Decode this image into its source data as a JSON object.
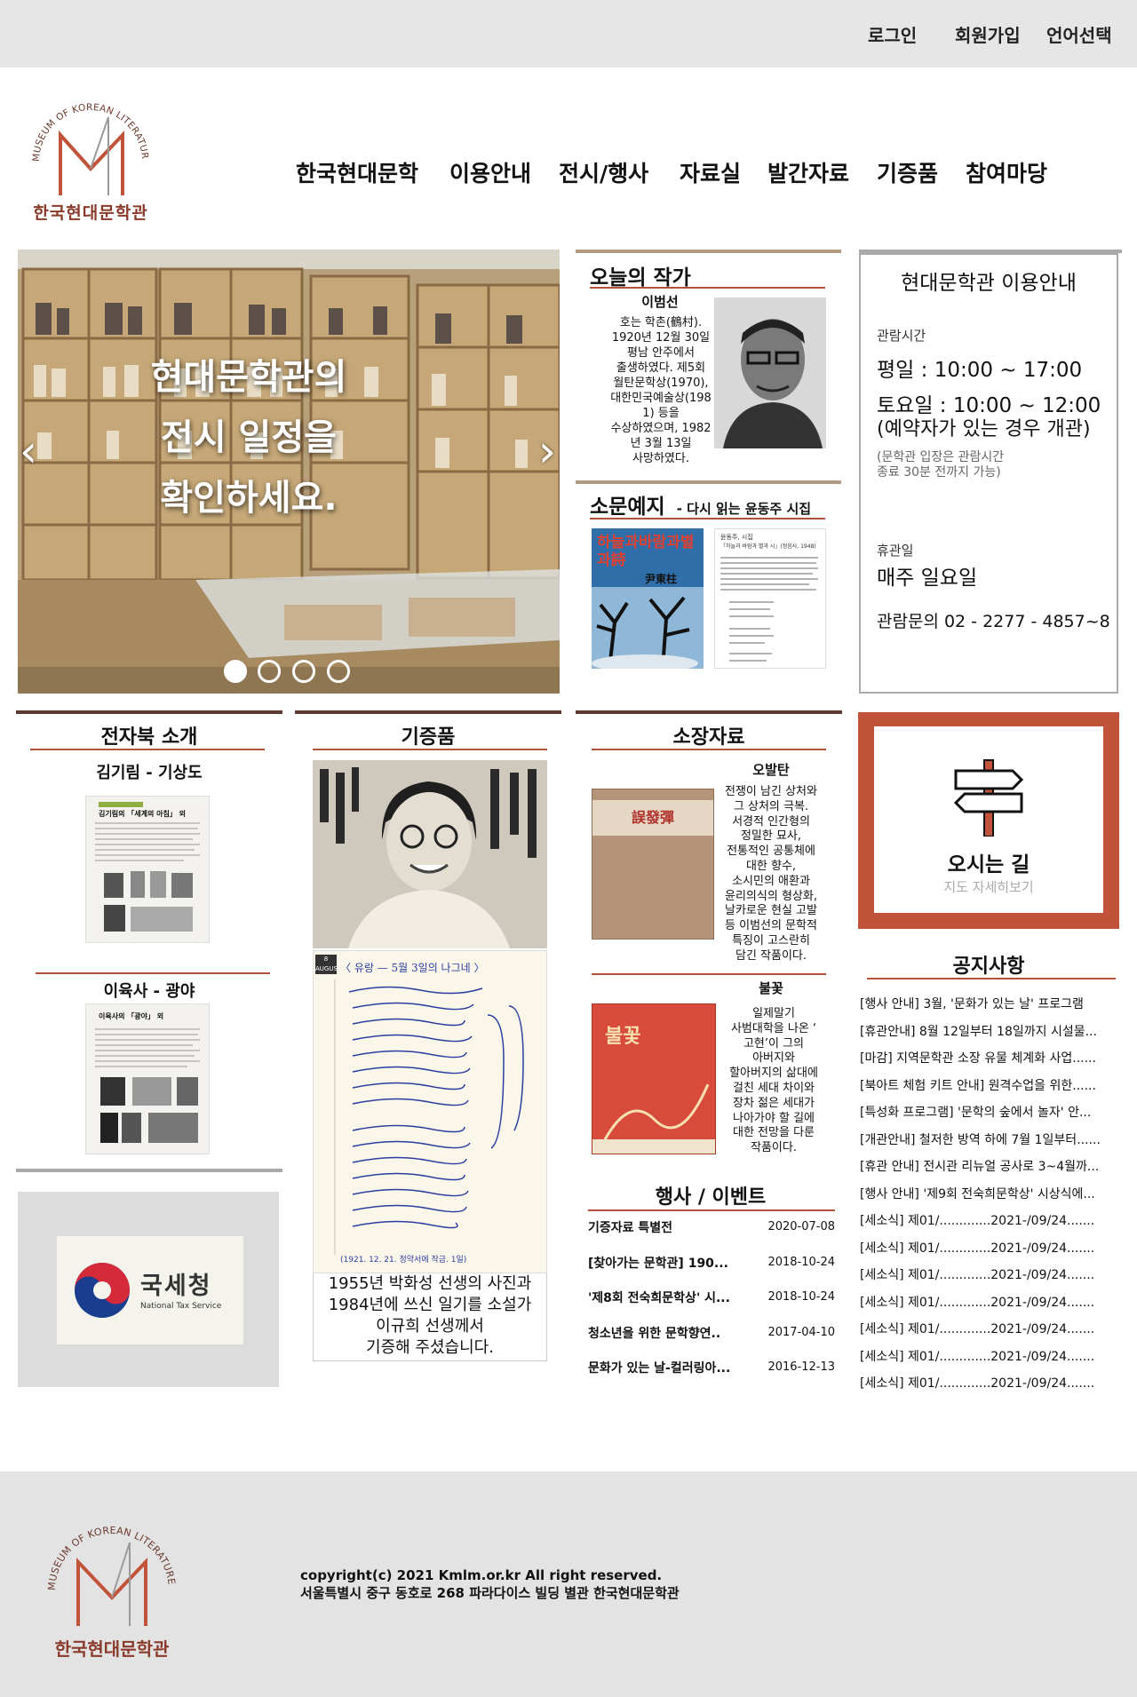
{
  "topbar": {
    "login": "로그인",
    "signup": "회원가입",
    "language": "언어선택"
  },
  "logo": {
    "arc_text": "MUSEUM OF KOREAN LITERATURE",
    "name": "한국현대문학관"
  },
  "nav": [
    "한국현대문학",
    "이용안내",
    "전시/행사",
    "자료실",
    "발간자료",
    "기증품",
    "참여마당"
  ],
  "hero": {
    "line1": "현대문학관의",
    "line2": "전시 일정을",
    "line3": "확인하세요.",
    "prev": "‹",
    "next": "›"
  },
  "author": {
    "title": "오늘의 작가",
    "name": "이범선",
    "bio": [
      "호는 학촌(鶴村).",
      "1920년 12월 30일",
      "평남 안주에서",
      "출생하였다. 제5회",
      "월탄문학상(1970),",
      "대한민국예술상(198",
      "1) 등을",
      "수상하였으며, 1982",
      "년 3월 13일",
      "사망하였다."
    ]
  },
  "newbook": {
    "title": "소문예지",
    "subtitle": "- 다시 읽는 윤동주 시집",
    "cover_title": "하늘과바람과별과詩",
    "cover_author": "尹東柱",
    "page_head": "윤동주, 시집",
    "page_sub": "「하늘과 바람과 별과 시」(정음사, 1948)"
  },
  "info": {
    "title": "현대문학관 이용안내",
    "hours_label": "관람시간",
    "weekday": "평일 : 10:00 ~ 17:00",
    "saturday": "토요일 : 10:00 ~ 12:00",
    "sat_note": "(예약자가 있는 경우 개관)",
    "entry_note1": "(문학관 입장은 관람시간",
    "entry_note2": "종료 30분 전까지 가능)",
    "closed_label": "휴관일",
    "closed": "매주 일요일",
    "contact": "관람문의 02 - 2277 - 4857~8"
  },
  "ebook": {
    "title": "전자북 소개",
    "items": [
      {
        "label": "김기림 - 기상도",
        "page_title": "김기림의 「세계의 아침」 외"
      },
      {
        "label": "이육사 - 광야",
        "page_title": "이육사의 「광야」 외"
      }
    ]
  },
  "donation": {
    "title": "기증품",
    "diary_date": "8 AUGUST",
    "diary_heading": "〈 유랑 — 5월 3일의 나그네 〉",
    "diary_footer": "(1921. 12. 21. 정약서에 작금. 1일)",
    "caption": [
      "1955년 박화성 선생의 사진과",
      "1984년에 쓰신 일기를 소설가",
      "이규희 선생께서",
      "기증해 주셨습니다."
    ]
  },
  "collection": {
    "title": "소장자료",
    "items": [
      {
        "name": "오발탄",
        "cover_title": "誤發彈",
        "desc": [
          "전쟁이 남긴 상처와",
          "그 상처의 극복.",
          "서경적 인간형의",
          "정밀한 묘사,",
          "전통적인 공통체에",
          "대한 향수,",
          "소시민의 애환과",
          "윤리의식의 형상화,",
          "날카로운 현실 고발",
          "등 이범선의 문학적",
          "특징이 고스란히",
          "담긴 작품이다."
        ]
      },
      {
        "name": "불꽃",
        "cover_title": "불꽃",
        "desc": [
          "일제말기",
          "사범대학을 나온 ‘",
          "고현’이 그의",
          "아버지와",
          "할아버지의 삶대에",
          "걸친 세대 차이와",
          "장차 젊은 세대가",
          "나아가야 할 길에",
          "대한 전망을 다룬",
          "작품이다."
        ]
      }
    ]
  },
  "directions": {
    "title": "오시는 길",
    "link": "지도 자세히보기",
    "icon": "signpost-icon"
  },
  "notices": {
    "title": "공지사항",
    "items": [
      "[행사 안내] 3월, '문화가 있는 날' 프로그램",
      "[휴관안내] 8월 12일부터 18일까지 시설물...",
      "[마감] 지역문학관 소장 유물 체계화 사업......",
      "[북아트 체험 키트 안내] 원격수업을 위한......",
      "[특성화 프로그램] '문학의 숲에서 놀자' 안...",
      "[개관안내] 철저한 방역 하에 7월 1일부터......",
      "[휴관 안내] 전시관 리뉴얼 공사로 3~4월까...",
      "[행사 안내] '제9회 전숙희문학상' 시상식에...",
      "[세소식] 제01/.............2021-/09/24.......",
      "[세소식] 제01/.............2021-/09/24.......",
      "[세소식] 제01/.............2021-/09/24.......",
      "[세소식] 제01/.............2021-/09/24.......",
      "[세소식] 제01/.............2021-/09/24.......",
      "[세소식] 제01/.............2021-/09/24.......",
      "[세소식] 제01/.............2021-/09/24......."
    ]
  },
  "events": {
    "title": "행사 / 이벤트",
    "items": [
      {
        "name": "기증자료 특별전",
        "date": "2020-07-08"
      },
      {
        "name": "[찾아가는 문학관] 190...",
        "date": "2018-10-24"
      },
      {
        "name": "'제8회 전숙희문학상' 시...",
        "date": "2018-10-24"
      },
      {
        "name": "청소년을 위한 문학향연..",
        "date": "2017-04-10"
      },
      {
        "name": "문화가 있는 날-컬러링아...",
        "date": "2016-12-13"
      }
    ]
  },
  "tax": {
    "name": "국세청",
    "english": "National Tax Service"
  },
  "footer": {
    "copyright": "copyright(c) 2021 Kmlm.or.kr All right reserved.",
    "address": "서울특별시 중구 동호로 268 파라다이스 빌딩 별관 한국현대문학관"
  },
  "colors": {
    "brand_red": "#c0533a",
    "brown_rule": "#5b3a30",
    "logo_text": "#8a3a2a",
    "topbar_bg": "#e6e6e6",
    "footer_bg": "#e3e3e3"
  }
}
